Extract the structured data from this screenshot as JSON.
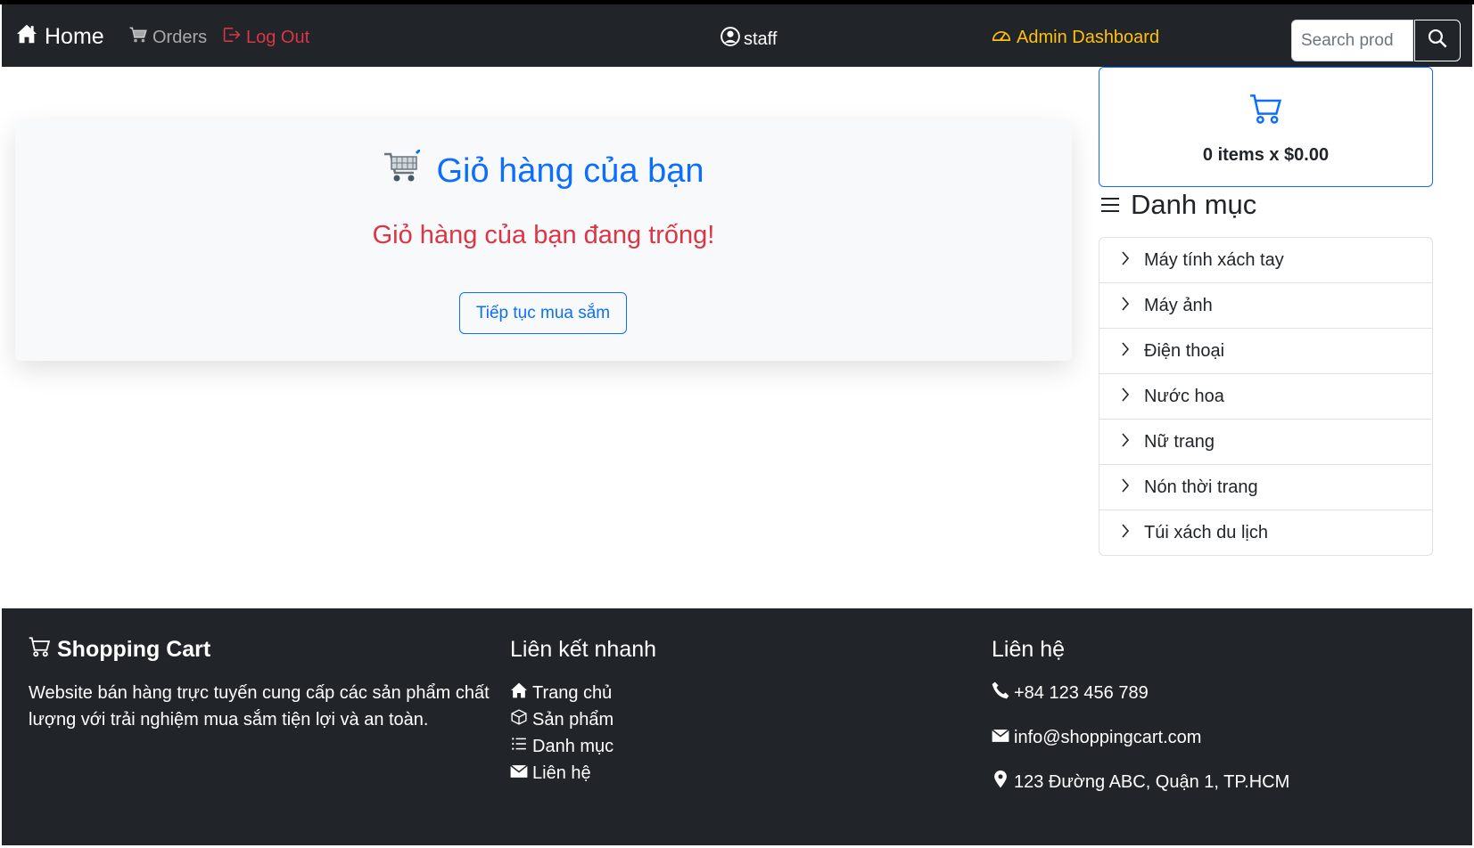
{
  "navbar": {
    "home_label": "Home",
    "orders_label": "Orders",
    "logout_label": "Log Out",
    "user_label": "staff",
    "admin_label": "Admin Dashboard",
    "search_placeholder": "Search prod",
    "colors": {
      "background": "#212529",
      "logout": "#dc3545",
      "admin": "#ffc107"
    }
  },
  "cart": {
    "title": "Giỏ hàng của bạn",
    "empty_message": "Giỏ hàng của bạn đang trống!",
    "continue_label": "Tiếp tục mua sắm",
    "colors": {
      "title": "#0d6efd",
      "empty": "#dc3545"
    }
  },
  "mini_cart": {
    "summary": "0 items x $0.00"
  },
  "categories": {
    "heading": "Danh mục",
    "items": [
      {
        "label": "Máy tính xách tay"
      },
      {
        "label": "Máy ảnh"
      },
      {
        "label": "Điện thoại"
      },
      {
        "label": "Nước hoa"
      },
      {
        "label": "Nữ trang"
      },
      {
        "label": "Nón thời trang"
      },
      {
        "label": "Túi xách du lịch"
      }
    ]
  },
  "footer": {
    "brand_title": "Shopping Cart",
    "brand_desc": "Website bán hàng trực tuyến cung cấp các sản phẩm chất lượng với trải nghiệm mua sắm tiện lợi và an toàn.",
    "links_title": "Liên kết nhanh",
    "links": [
      {
        "label": "Trang chủ",
        "icon": "house-icon"
      },
      {
        "label": "Sản phẩm",
        "icon": "box-icon"
      },
      {
        "label": "Danh mục",
        "icon": "list-icon"
      },
      {
        "label": "Liên hệ",
        "icon": "envelope-icon"
      }
    ],
    "contact_title": "Liên hệ",
    "phone": "+84 123 456 789",
    "email": "info@shoppingcart.com",
    "address": "123 Đường ABC, Quận 1, TP.HCM"
  }
}
